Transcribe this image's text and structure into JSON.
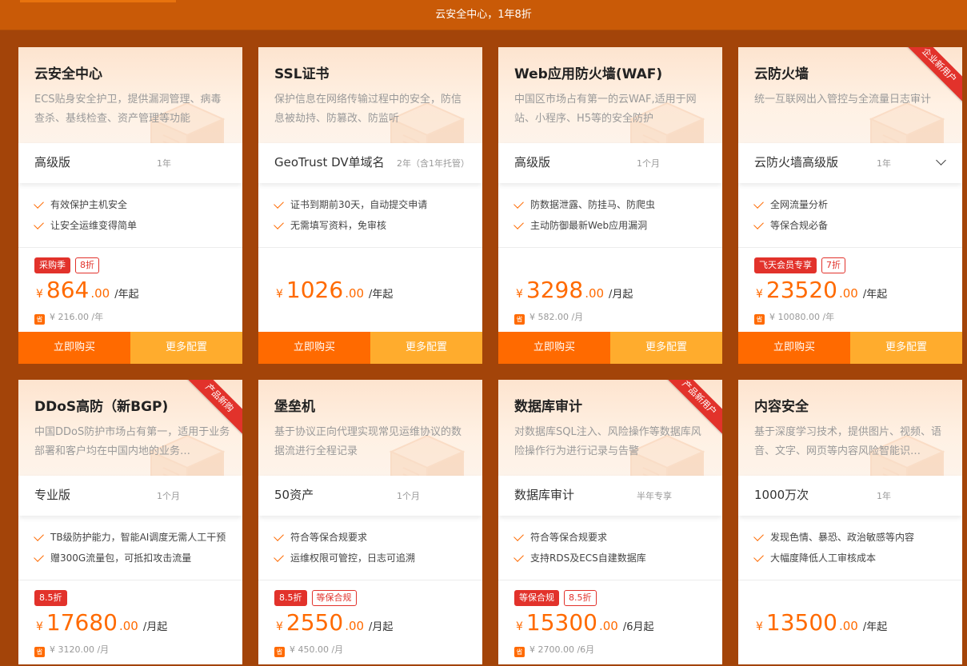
{
  "banner": {
    "title": "云安全中心，1年8折"
  },
  "actions": {
    "buy": "立即购买",
    "more": "更多配置"
  },
  "currency": "¥",
  "save_icon": "省",
  "cards": [
    {
      "title": "云安全中心",
      "desc": "ECS贴身安全护卫，提供漏洞管理、病毒查杀、基线检查、资产管理等功能",
      "ribbon": "",
      "spec": "高级版",
      "duration": "1年",
      "has_dropdown": false,
      "features": [
        "有效保护主机安全",
        "让安全运维变得简单"
      ],
      "tags": [
        {
          "text": "采购季",
          "style": "solid"
        },
        {
          "text": "8折",
          "style": "outline"
        }
      ],
      "price_int": "864",
      "price_dec": ".00",
      "unit": "/年起",
      "save": "¥ 216.00 /年",
      "show_actions": true
    },
    {
      "title": "SSL证书",
      "desc": "保护信息在网络传输过程中的安全，防信息被劫持、防篡改、防监听",
      "ribbon": "",
      "spec": "GeoTrust DV单域名",
      "duration": "2年（含1年托管）",
      "has_dropdown": false,
      "features": [
        "证书到期前30天，自动提交申请",
        "无需填写资料，免审核"
      ],
      "tags": [],
      "price_int": "1026",
      "price_dec": ".00",
      "unit": "/年起",
      "save": "",
      "show_actions": true
    },
    {
      "title": "Web应用防火墙(WAF)",
      "desc": "中国区市场占有第一的云WAF,适用于网站、小程序、H5等的安全防护",
      "ribbon": "",
      "spec": "高级版",
      "duration": "1个月",
      "has_dropdown": false,
      "features": [
        "防数据泄露、防挂马、防爬虫",
        "主动防御最新Web应用漏洞"
      ],
      "tags": [],
      "price_int": "3298",
      "price_dec": ".00",
      "unit": "/月起",
      "save": "¥ 582.00 /月",
      "show_actions": true
    },
    {
      "title": "云防火墙",
      "desc": "统一互联网出入管控与全流量日志审计",
      "ribbon": "企业新用户",
      "spec": "云防火墙高级版",
      "duration": "1年",
      "has_dropdown": true,
      "features": [
        "全网流量分析",
        "等保合规必备"
      ],
      "tags": [
        {
          "text": "飞天会员专享",
          "style": "solid"
        },
        {
          "text": "7折",
          "style": "outline"
        }
      ],
      "price_int": "23520",
      "price_dec": ".00",
      "unit": "/年起",
      "save": "¥ 10080.00 /年",
      "show_actions": true
    },
    {
      "title": "DDoS高防（新BGP)",
      "desc": "中国DDoS防护市场占有第一，适用于业务部署和客户均在中国内地的业务…",
      "ribbon": "产品新购",
      "spec": "专业版",
      "duration": "1个月",
      "has_dropdown": false,
      "features": [
        "TB级防护能力，智能AI调度无需人工干预",
        "赠300G流量包，可抵扣攻击流量"
      ],
      "tags": [
        {
          "text": "8.5折",
          "style": "solid"
        }
      ],
      "price_int": "17680",
      "price_dec": ".00",
      "unit": "/月起",
      "save": "¥ 3120.00 /月",
      "show_actions": false
    },
    {
      "title": "堡垒机",
      "desc": "基于协议正向代理实现常见运维协议的数据流进行全程记录",
      "ribbon": "",
      "spec": "50资产",
      "duration": "1个月",
      "has_dropdown": false,
      "features": [
        "符合等保合规要求",
        "运维权限可管控，日志可追溯"
      ],
      "tags": [
        {
          "text": "8.5折",
          "style": "solid"
        },
        {
          "text": "等保合规",
          "style": "outline"
        }
      ],
      "price_int": "2550",
      "price_dec": ".00",
      "unit": "/月起",
      "save": "¥ 450.00 /月",
      "show_actions": false
    },
    {
      "title": "数据库审计",
      "desc": "对数据库SQL注入、风险操作等数据库风险操作行为进行记录与告警",
      "ribbon": "产品新用户",
      "spec": "数据库审计",
      "duration": "半年专享",
      "has_dropdown": false,
      "features": [
        "符合等保合规要求",
        "支持RDS及ECS自建数据库"
      ],
      "tags": [
        {
          "text": "等保合规",
          "style": "solid"
        },
        {
          "text": "8.5折",
          "style": "outline"
        }
      ],
      "price_int": "15300",
      "price_dec": ".00",
      "unit": "/6月起",
      "save": "¥ 2700.00 /6月",
      "show_actions": false
    },
    {
      "title": "内容安全",
      "desc": "基于深度学习技术，提供图片、视频、语音、文字、网页等内容风险智能识…",
      "ribbon": "",
      "spec": "1000万次",
      "duration": "1年",
      "has_dropdown": false,
      "features": [
        "发现色情、暴恐、政治敏感等内容",
        "大幅度降低人工审核成本"
      ],
      "tags": [],
      "price_int": "13500",
      "price_dec": ".00",
      "unit": "/年起",
      "save": "",
      "show_actions": false
    }
  ]
}
